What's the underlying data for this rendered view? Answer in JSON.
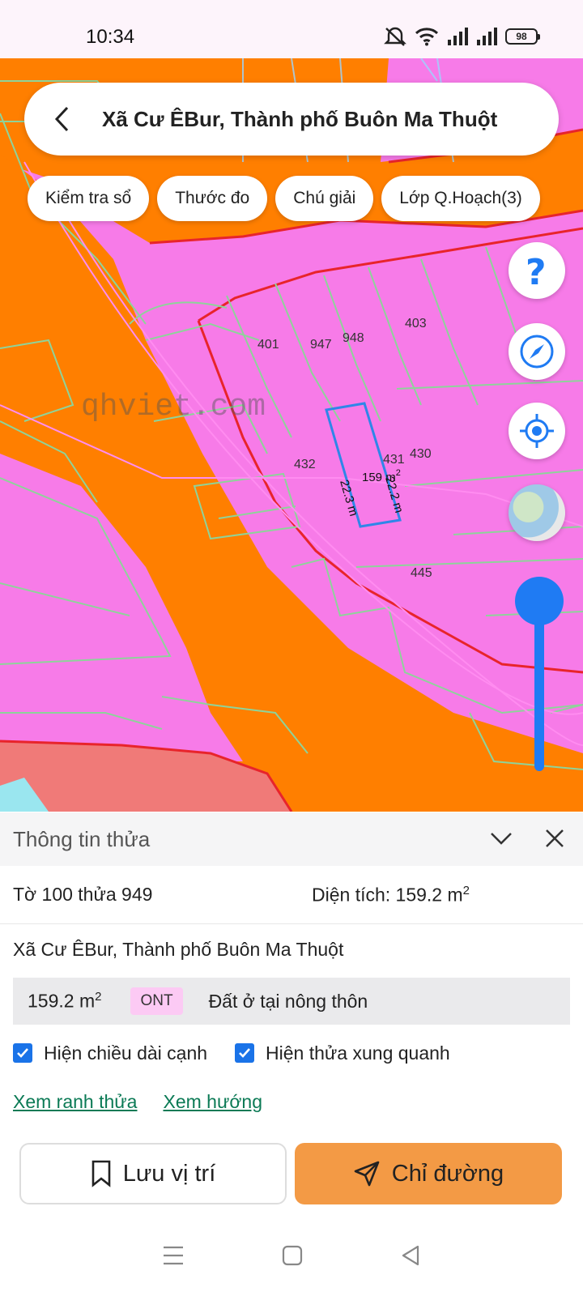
{
  "status_bar": {
    "time": "10:34",
    "battery": "98"
  },
  "search": {
    "title": "Xã Cư ÊBur, Thành phố Buôn Ma Thuột"
  },
  "chips": [
    {
      "label": "Kiểm tra sổ"
    },
    {
      "label": "Thước đo"
    },
    {
      "label": "Chú giải"
    },
    {
      "label": "Lớp Q.Hoạch(3)"
    }
  ],
  "map": {
    "watermark": "qhviet.com",
    "parcel_labels": [
      "401",
      "947",
      "948",
      "403",
      "431",
      "430",
      "432",
      "445"
    ],
    "selected_area": "159 m",
    "selected_area_sup": "2",
    "edge_left": "22.3 m",
    "edge_right": "22.2 m",
    "colors": {
      "residential": "#f77be8",
      "road": "#ff7f00",
      "selected_outline": "#2f86e8"
    }
  },
  "panel": {
    "title": "Thông tin thửa",
    "sheet_parcel": "Tờ 100 thửa 949",
    "area_label": "Diện tích: 159.2 m",
    "area_sup": "2",
    "address": "Xã Cư ÊBur, Thành phố Buôn Ma Thuột",
    "land_area": "159.2 m",
    "land_area_sup": "2",
    "land_code": "ONT",
    "land_type": "Đất ở tại nông thôn",
    "check_edges": "Hiện chiều dài cạnh",
    "check_neighbors": "Hiện thửa xung quanh",
    "link_boundary": "Xem ranh thửa",
    "link_direction": "Xem hướng",
    "save_label": "Lưu vị trí",
    "directions_label": "Chỉ đường"
  }
}
